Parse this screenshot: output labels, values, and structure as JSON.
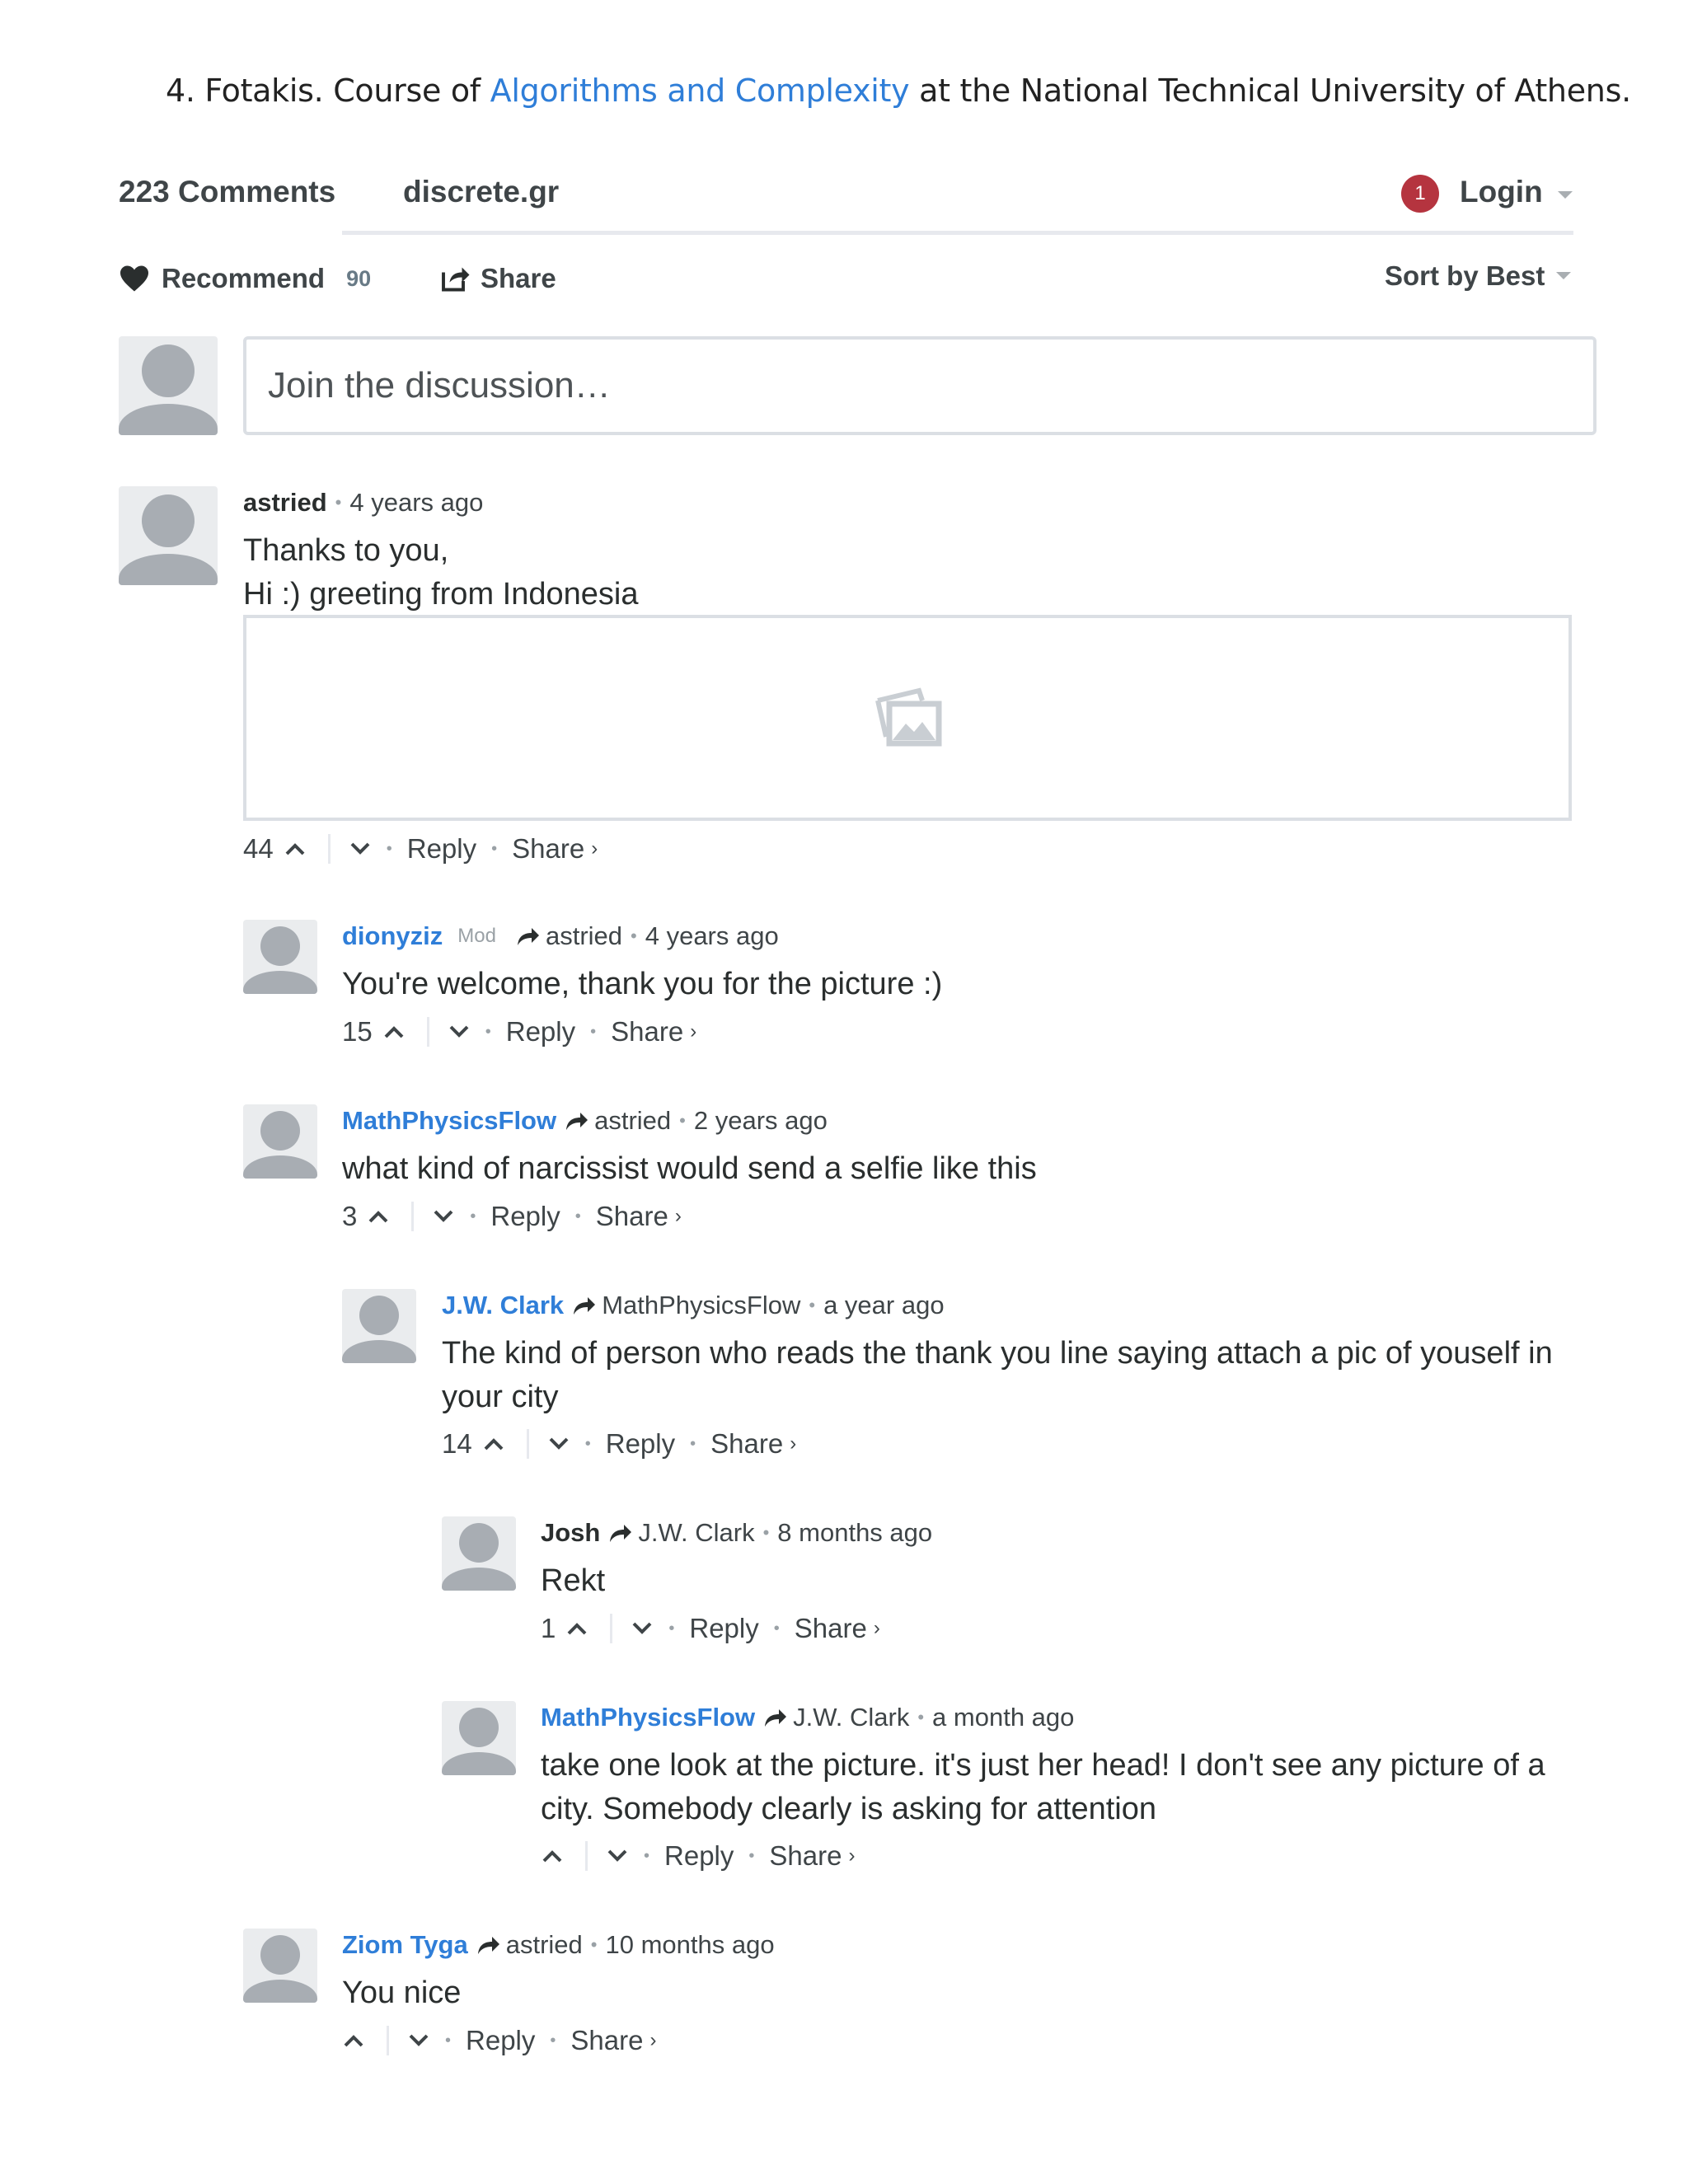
{
  "reference": {
    "prefix": "4. Fotakis. Course of ",
    "link_text": "Algorithms and Complexity",
    "suffix": " at the National Technical University of Athens."
  },
  "header": {
    "comment_count": "223 Comments",
    "site": "discrete.gr",
    "notifications": "1",
    "login": "Login",
    "recommend_label": "Recommend",
    "recommend_count": "90",
    "share_label": "Share",
    "sort_label": "Sort by Best"
  },
  "compose": {
    "placeholder": "Join the discussion…"
  },
  "comments": [
    {
      "author": "astried",
      "time": "4 years ago",
      "lines": [
        "Thanks to you,",
        "Hi :) greeting from Indonesia"
      ],
      "votes": "44",
      "reply": "Reply",
      "share": "Share"
    },
    {
      "author": "dionyziz",
      "badge": "Mod",
      "parent": "astried",
      "time": "4 years ago",
      "lines": [
        "You're welcome, thank you for the picture :)"
      ],
      "votes": "15",
      "reply": "Reply",
      "share": "Share"
    },
    {
      "author": "MathPhysicsFlow",
      "parent": "astried",
      "time": "2 years ago",
      "lines": [
        "what kind of narcissist would send a selfie like this"
      ],
      "votes": "3",
      "reply": "Reply",
      "share": "Share"
    },
    {
      "author": "J.W. Clark",
      "parent": "MathPhysicsFlow",
      "time": "a year ago",
      "lines": [
        "The kind of person who reads the thank you line saying attach a pic of youself in",
        "your city"
      ],
      "votes": "14",
      "reply": "Reply",
      "share": "Share"
    },
    {
      "author": "Josh",
      "parent": "J.W. Clark",
      "time": "8 months ago",
      "lines": [
        "Rekt"
      ],
      "votes": "1",
      "reply": "Reply",
      "share": "Share"
    },
    {
      "author": "MathPhysicsFlow",
      "parent": "J.W. Clark",
      "time": "a month ago",
      "lines": [
        "take one look at the picture. it's just her head! I don't see any picture of a",
        "city. Somebody clearly is asking for attention"
      ],
      "votes": "",
      "reply": "Reply",
      "share": "Share"
    },
    {
      "author": "Ziom Tyga",
      "parent": "astried",
      "time": "10 months ago",
      "lines": [
        "You nice"
      ],
      "votes": "",
      "reply": "Reply",
      "share": "Share"
    }
  ],
  "colors": {
    "link": "#2f7ed8",
    "badge": "#b5343f",
    "text": "#2a2e2e",
    "muted": "#9aa1a6"
  },
  "icons": [
    "heart-icon",
    "share-icon",
    "reply-arrow-icon",
    "upvote-icon",
    "downvote-icon",
    "image-placeholder-icon",
    "caret-down-icon"
  ]
}
